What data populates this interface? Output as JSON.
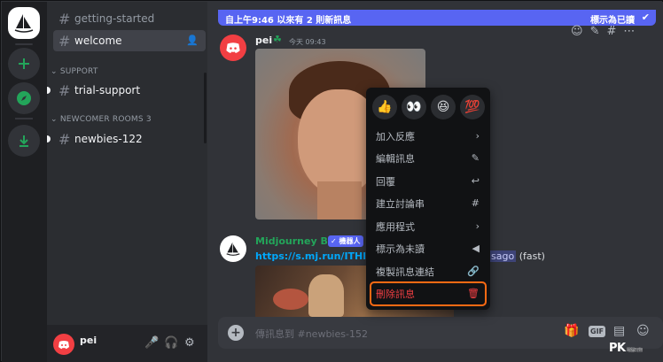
{
  "rail": {
    "home_icon": "sailboat-logo-icon",
    "add_icon": "plus-icon",
    "explore_icon": "compass-icon",
    "download_icon": "download-icon"
  },
  "channels": {
    "getting_started": "getting-started",
    "welcome": "welcome",
    "support_category": "SUPPORT",
    "trial_support": "trial-support",
    "newcomer_category": "NEWCOMER ROOMS 3",
    "newbies": "newbies-122"
  },
  "user_panel": {
    "username": "pei"
  },
  "banner": {
    "left_text": "自上午9:46 以來有 2 則新訊息",
    "right_text": "標示為已讀",
    "color": "#5865f2"
  },
  "messages": [
    {
      "author": "pei",
      "timestamp": "今天 09:43",
      "author_color": "#f2f3f5"
    },
    {
      "author": "Midjourney Bot",
      "badge": "✓ 機器人",
      "link_text": "https://s.mj.run/ITHlNt",
      "suffix_highlight": "sago",
      "suffix_text": "(fast)",
      "author_color": "#23a55a"
    }
  ],
  "context_menu": {
    "emojis": [
      "👍",
      "👀",
      "😆",
      "💯"
    ],
    "items": [
      {
        "label": "加入反應",
        "icon": "›"
      },
      {
        "label": "編輯訊息",
        "icon": "✎"
      },
      {
        "label": "回覆",
        "icon": "↩"
      },
      {
        "label": "建立討論串",
        "icon": "#"
      },
      {
        "label": "應用程式",
        "icon": "›"
      },
      {
        "label": "標示為未讀",
        "icon": "◀"
      },
      {
        "label": "複製訊息連結",
        "icon": "🔗"
      }
    ],
    "delete_label": "刪除訊息",
    "delete_icon": "🗑",
    "danger_color": "#f23f43",
    "highlight_color": "#ff6a13"
  },
  "composer": {
    "placeholder": "傳訊息到 #newbies-152",
    "gif_label": "GIF"
  },
  "watermark": {
    "logo": "PK",
    "tag": "電腦玩物"
  }
}
